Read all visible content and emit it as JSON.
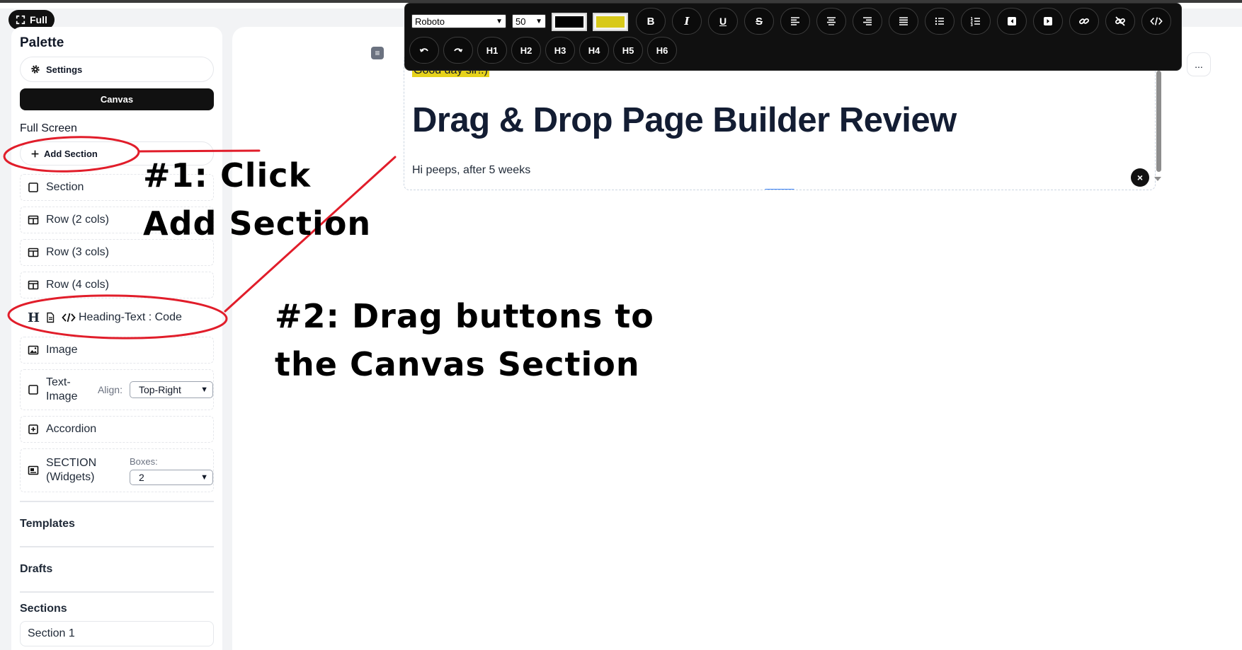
{
  "app": {
    "full_button_label": "Full"
  },
  "sidebar": {
    "title": "Palette",
    "settings_label": "Settings",
    "canvas_label": "Canvas",
    "fullscreen_label": "Full Screen",
    "add_section_label": "Add Section",
    "items": [
      {
        "label": "Section",
        "icon": "square-icon"
      },
      {
        "label": "Row (2 cols)",
        "icon": "columns-icon"
      },
      {
        "label": "Row (3 cols)",
        "icon": "columns-icon"
      },
      {
        "label": "Row (4 cols)",
        "icon": "columns-icon"
      }
    ],
    "heading_item": {
      "glyph": "H",
      "label": "Heading-Text : Code"
    },
    "image_label": "Image",
    "text_image": {
      "label": "Text-\nImage",
      "align_label": "Align:",
      "align_value": "Top-Right"
    },
    "accordion_label": "Accordion",
    "widgets": {
      "label": "SECTION\n(Widgets)",
      "boxes_label": "Boxes:",
      "boxes_value": "2"
    },
    "templates_heading": "Templates",
    "drafts_heading": "Drafts",
    "sections_heading": "Sections",
    "section_entry": "Section 1"
  },
  "toolbar": {
    "font_value": "Roboto",
    "size_value": "50",
    "text_color": "#000000",
    "highlight_color": "#d8c91a",
    "row1_buttons": [
      "bold-icon",
      "italic-icon",
      "underline-icon",
      "strikethrough-icon",
      "align-left-icon",
      "align-center-icon",
      "align-right-icon",
      "align-justify-icon",
      "bullet-list-icon",
      "numbered-list-icon",
      "outdent-icon",
      "indent-icon",
      "link-icon",
      "unlink-icon",
      "code-icon"
    ],
    "row1_labels": [
      "B",
      "I",
      "U",
      "S"
    ],
    "row2_headings": [
      "H1",
      "H2",
      "H3",
      "H4",
      "H5",
      "H6"
    ]
  },
  "canvas": {
    "greeting": "Good day sir!:)",
    "heading": "Drag & Drop Page Builder Review",
    "paragraph": "Hi peeps,  after 5 weeks",
    "handle_glyph": "≡",
    "more_glyph": "...",
    "close_glyph": "×"
  },
  "annotations": {
    "step1": "#1: Click\nAdd Section",
    "step2": "#2: Drag buttons to\nthe Canvas Section",
    "ink_color": "#e11d2a"
  }
}
